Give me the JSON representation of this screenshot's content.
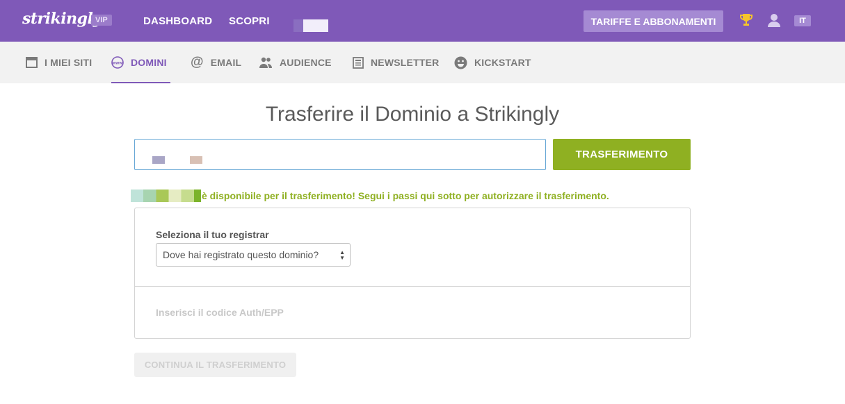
{
  "brand": {
    "logo_text": "strikingly",
    "badge": "VIP"
  },
  "topnav": {
    "dashboard": "DASHBOARD",
    "discover": "SCOPRI"
  },
  "header": {
    "pricing_label": "TARIFFE E ABBONAMENTI",
    "language": "IT"
  },
  "subnav": {
    "tabs": [
      {
        "label": "I MIEI SITI",
        "icon": "browser-window-icon",
        "active": false
      },
      {
        "label": "DOMINI",
        "icon": "www-icon",
        "active": true
      },
      {
        "label": "EMAIL",
        "icon": "at-icon",
        "active": false
      },
      {
        "label": "AUDIENCE",
        "icon": "people-icon",
        "active": false
      },
      {
        "label": "NEWSLETTER",
        "icon": "newsletter-icon",
        "active": false
      },
      {
        "label": "KICKSTART",
        "icon": "smiley-icon",
        "active": false
      }
    ]
  },
  "main": {
    "title": "Trasferire il Dominio a Strikingly",
    "transfer_button": "TRASFERIMENTO",
    "availability_message": "è disponibile per il trasferimento! Segui i passi qui sotto per autorizzare il trasferimento."
  },
  "registrar": {
    "label": "Seleziona il tuo registrar",
    "selected_option": "Dove hai registrato questo dominio?"
  },
  "auth": {
    "label": "Inserisci il codice Auth/EPP"
  },
  "continue_button": "CONTINUA IL TRASFERIMENTO",
  "colors": {
    "brand_purple": "#7f59b8",
    "accent_green": "#8fb022",
    "input_border": "#68a8d6"
  }
}
